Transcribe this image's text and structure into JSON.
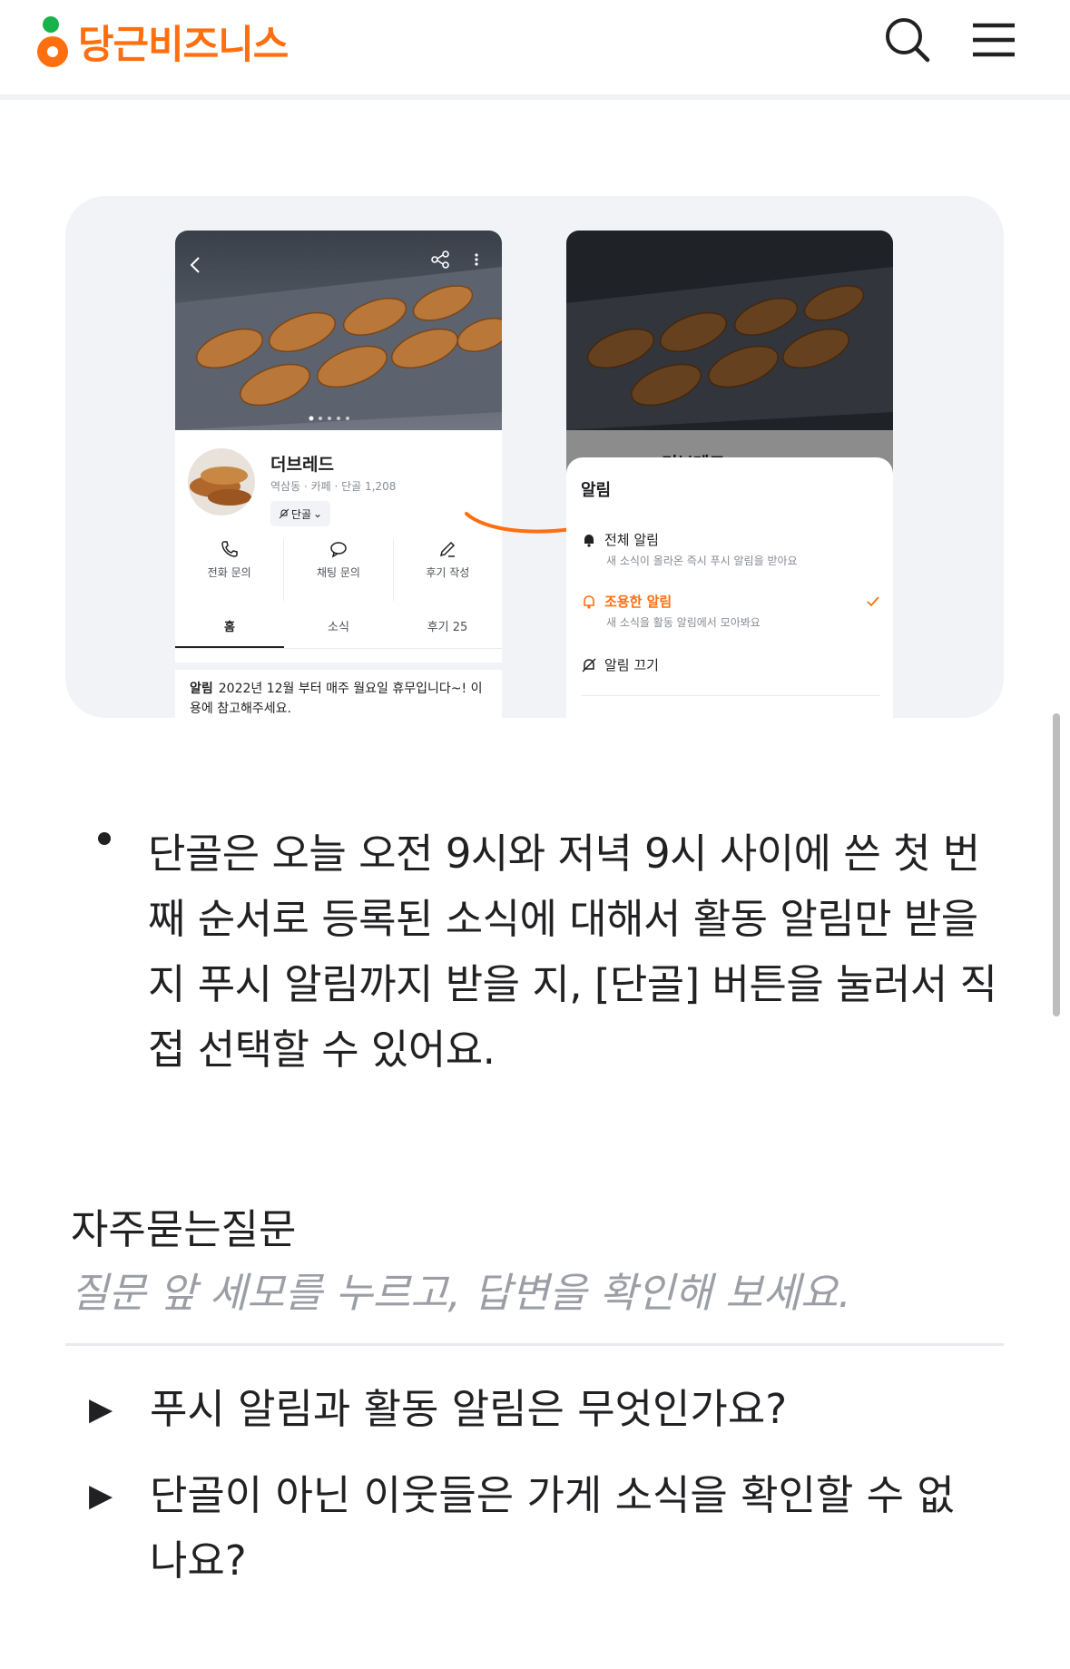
{
  "header": {
    "brand": "당근비즈니스",
    "search_icon": "search-icon",
    "menu_icon": "hamburger-menu-icon",
    "brand_color": "#ff6f0f"
  },
  "hero": {
    "left_phone": {
      "store_name": "더브레드",
      "store_meta": "역삼동 · 카페 · 단골 1,208",
      "dangol_button": "단골",
      "actions": [
        "전화 문의",
        "채팅 문의",
        "후기 작성"
      ],
      "tabs": [
        "홈",
        "소식",
        "후기 25"
      ],
      "notice_label": "알림",
      "notice_text": "2022년 12월 부터 매주 월요일 휴무입니다~! 이용에 참고해주세요."
    },
    "right_phone": {
      "store_name_partial": "더브레드",
      "sheet_title": "알림",
      "options": [
        {
          "title": "전체 알림",
          "sub": "새 소식이 올라온 즉시 푸시 알림을 받아요"
        },
        {
          "title": "조용한 알림",
          "sub": "새 소식을 활동 알림에서 모아봐요"
        },
        {
          "title": "알림 끄기",
          "sub": ""
        }
      ]
    }
  },
  "body": {
    "paragraph": "단골은 오늘 오전 9시와 저녁 9시 사이에 쓴 첫 번째 순서로 등록된 소식에 대해서 활동 알림만 받을 지 푸시 알림까지 받을 지, [단골] 버튼을 눌러서 직접 선택할 수 있어요."
  },
  "faq": {
    "title": "자주묻는질문",
    "subtitle": "질문 앞 세모를 누르고, 답변을 확인해 보세요.",
    "items": [
      "푸시 알림과 활동 알림은 무엇인가요?",
      "단골이 아닌 이웃들은 가게 소식을 확인할 수 없나요?"
    ]
  }
}
